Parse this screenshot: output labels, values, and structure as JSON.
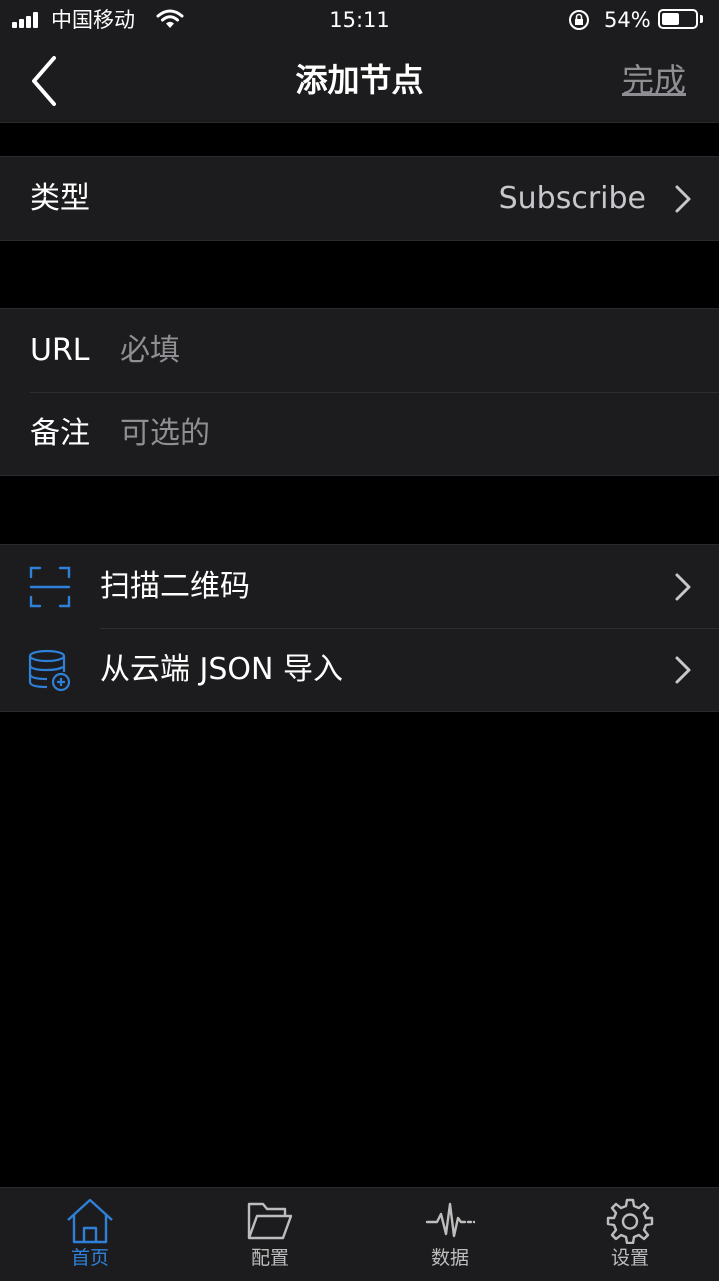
{
  "status_bar": {
    "carrier": "中国移动",
    "time": "15:11",
    "battery_text": "54%",
    "battery_level": 0.54
  },
  "nav": {
    "title": "添加节点",
    "done_label": "完成",
    "back_icon": "chevron-left-icon"
  },
  "type_row": {
    "label": "类型",
    "value": "Subscribe"
  },
  "form": {
    "url": {
      "label": "URL",
      "placeholder": "必填",
      "value": ""
    },
    "remark": {
      "label": "备注",
      "placeholder": "可选的",
      "value": ""
    }
  },
  "actions": [
    {
      "label": "扫描二维码",
      "icon": "qr-scan-icon"
    },
    {
      "label": "从云端 JSON 导入",
      "icon": "database-add-icon"
    }
  ],
  "tabbar": {
    "items": [
      {
        "label": "首页",
        "icon": "home-icon",
        "active": true
      },
      {
        "label": "配置",
        "icon": "folder-icon",
        "active": false
      },
      {
        "label": "数据",
        "icon": "pulse-icon",
        "active": false
      },
      {
        "label": "设置",
        "icon": "gear-icon",
        "active": false
      }
    ]
  },
  "colors": {
    "background": "#000000",
    "cell": "#1c1c1e",
    "accent": "#2f80d8",
    "secondary_text": "#8e8e93"
  }
}
